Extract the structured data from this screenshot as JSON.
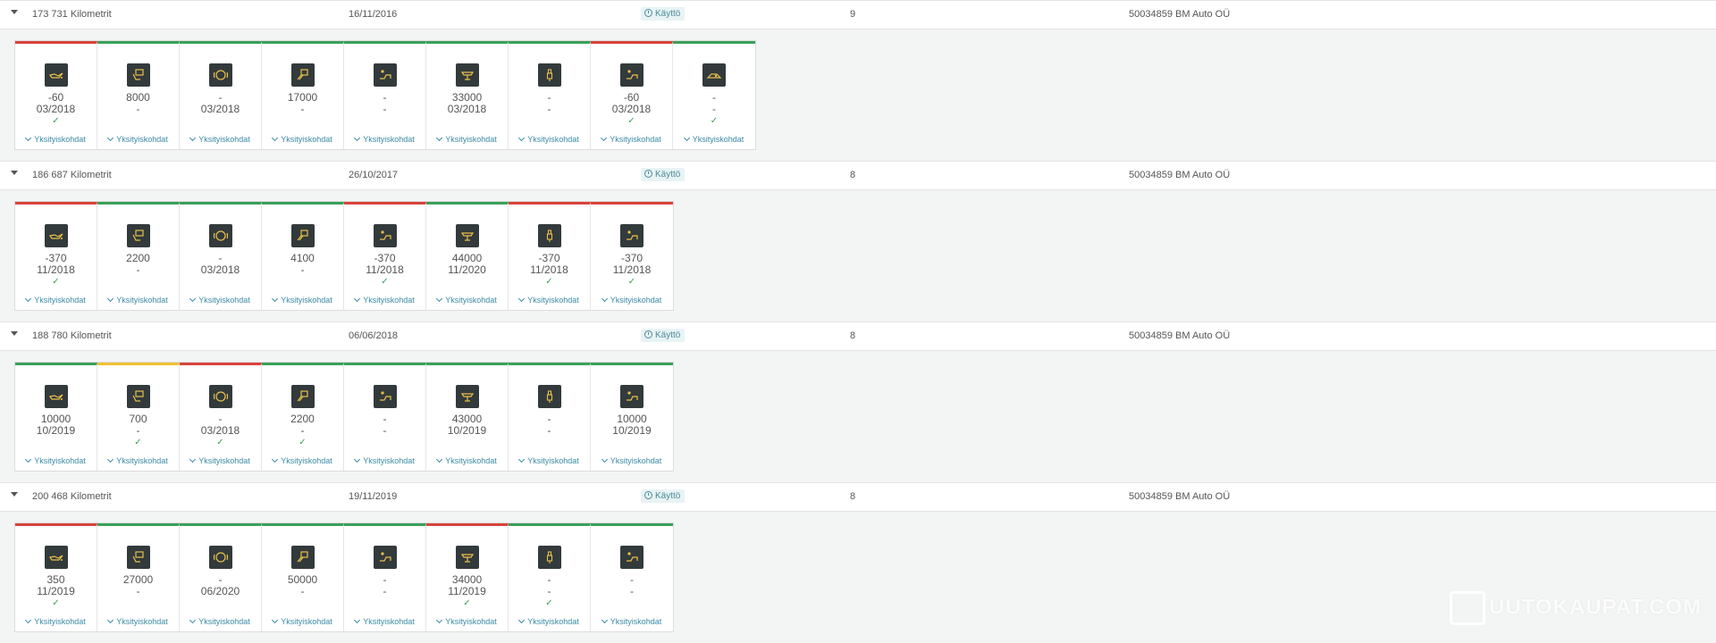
{
  "details_label": "Yksityiskohdat",
  "status_label": "Käyttö",
  "watermark": "UUTOKAUPAT.COM",
  "colors": {
    "red": "#d9433b",
    "green": "#3aa05a",
    "yellow": "#f1c231",
    "link": "#3a8aa5"
  },
  "records": [
    {
      "km": "173 731 Kilometrit",
      "date": "16/11/2016",
      "count": "9",
      "owner": "50034859 BM Auto OÜ",
      "cards": [
        {
          "icon": "oil-can-icon",
          "status": "red",
          "value": "-60",
          "due": "03/2018",
          "check": true
        },
        {
          "icon": "fuel-filter-icon",
          "status": "green",
          "value": "8000",
          "due": "-",
          "check": false
        },
        {
          "icon": "brake-disc-icon",
          "status": "green",
          "value": "-",
          "due": "03/2018",
          "check": false
        },
        {
          "icon": "air-filter-icon",
          "status": "green",
          "value": "17000",
          "due": "-",
          "check": false
        },
        {
          "icon": "cabin-filter-icon",
          "status": "green",
          "value": "-",
          "due": "-",
          "check": false
        },
        {
          "icon": "oil-service-icon",
          "status": "green",
          "value": "33000",
          "due": "03/2018",
          "check": false
        },
        {
          "icon": "spark-plug-icon",
          "status": "green",
          "value": "-",
          "due": "-",
          "check": false
        },
        {
          "icon": "cabin-filter-icon",
          "status": "red",
          "value": "-60",
          "due": "03/2018",
          "check": true
        },
        {
          "icon": "brake-pads-icon",
          "status": "green",
          "value": "-",
          "due": "-",
          "check": true
        }
      ]
    },
    {
      "km": "186 687 Kilometrit",
      "date": "26/10/2017",
      "count": "8",
      "owner": "50034859 BM Auto OÜ",
      "cards": [
        {
          "icon": "oil-can-icon",
          "status": "red",
          "value": "-370",
          "due": "11/2018",
          "check": true
        },
        {
          "icon": "fuel-filter-icon",
          "status": "green",
          "value": "2200",
          "due": "-",
          "check": false
        },
        {
          "icon": "brake-disc-icon",
          "status": "green",
          "value": "-",
          "due": "03/2018",
          "check": false
        },
        {
          "icon": "air-filter-icon",
          "status": "green",
          "value": "4100",
          "due": "-",
          "check": false
        },
        {
          "icon": "cabin-filter-icon",
          "status": "red",
          "value": "-370",
          "due": "11/2018",
          "check": true
        },
        {
          "icon": "oil-service-icon",
          "status": "green",
          "value": "44000",
          "due": "11/2020",
          "check": false
        },
        {
          "icon": "spark-plug-icon",
          "status": "red",
          "value": "-370",
          "due": "11/2018",
          "check": true
        },
        {
          "icon": "cabin-filter-icon",
          "status": "red",
          "value": "-370",
          "due": "11/2018",
          "check": true
        }
      ]
    },
    {
      "km": "188 780 Kilometrit",
      "date": "06/06/2018",
      "count": "8",
      "owner": "50034859 BM Auto OÜ",
      "cards": [
        {
          "icon": "oil-can-icon",
          "status": "green",
          "value": "10000",
          "due": "10/2019",
          "check": false
        },
        {
          "icon": "fuel-filter-icon",
          "status": "yellow",
          "value": "700",
          "due": "-",
          "check": true
        },
        {
          "icon": "brake-disc-icon",
          "status": "red",
          "value": "-",
          "due": "03/2018",
          "check": true
        },
        {
          "icon": "air-filter-icon",
          "status": "green",
          "value": "2200",
          "due": "-",
          "check": true
        },
        {
          "icon": "cabin-filter-icon",
          "status": "green",
          "value": "-",
          "due": "-",
          "check": false
        },
        {
          "icon": "oil-service-icon",
          "status": "green",
          "value": "43000",
          "due": "10/2019",
          "check": false
        },
        {
          "icon": "spark-plug-icon",
          "status": "green",
          "value": "-",
          "due": "-",
          "check": false
        },
        {
          "icon": "cabin-filter-icon",
          "status": "green",
          "value": "10000",
          "due": "10/2019",
          "check": false
        }
      ]
    },
    {
      "km": "200 468 Kilometrit",
      "date": "19/11/2019",
      "count": "8",
      "owner": "50034859 BM Auto OÜ",
      "cards": [
        {
          "icon": "oil-can-icon",
          "status": "red",
          "value": "350",
          "due": "11/2019",
          "check": true
        },
        {
          "icon": "fuel-filter-icon",
          "status": "green",
          "value": "27000",
          "due": "-",
          "check": false
        },
        {
          "icon": "brake-disc-icon",
          "status": "green",
          "value": "-",
          "due": "06/2020",
          "check": false
        },
        {
          "icon": "air-filter-icon",
          "status": "green",
          "value": "50000",
          "due": "-",
          "check": false
        },
        {
          "icon": "cabin-filter-icon",
          "status": "green",
          "value": "-",
          "due": "-",
          "check": false
        },
        {
          "icon": "oil-service-icon",
          "status": "red",
          "value": "34000",
          "due": "11/2019",
          "check": true
        },
        {
          "icon": "spark-plug-icon",
          "status": "green",
          "value": "-",
          "due": "-",
          "check": true
        },
        {
          "icon": "cabin-filter-icon",
          "status": "green",
          "value": "-",
          "due": "-",
          "check": false
        }
      ]
    }
  ]
}
